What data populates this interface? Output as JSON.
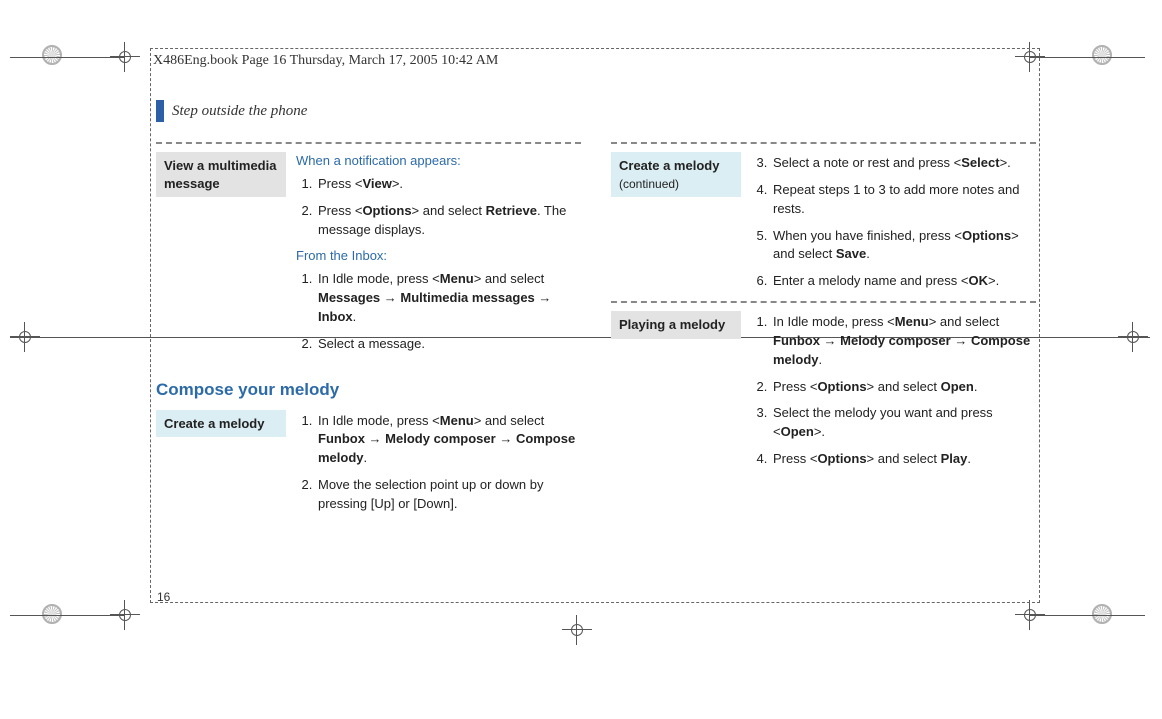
{
  "doc_header": "X486Eng.book  Page 16  Thursday, March 17, 2005  10:42 AM",
  "section_title": "Step outside the phone",
  "page_number": "16",
  "left": {
    "view_mm": {
      "label": "View a multimedia message",
      "notif_heading": "When a notification appears:",
      "notif_steps": [
        "Press <View>.",
        "Press <Options> and select Retrieve. The message displays."
      ],
      "inbox_heading": "From the Inbox:",
      "inbox_steps": [
        "In Idle mode, press <Menu> and select Messages → Multimedia messages → Inbox.",
        "Select a message."
      ]
    },
    "compose_heading": "Compose your melody",
    "create_melody": {
      "label": "Create a melody",
      "steps": [
        "In Idle mode, press <Menu> and select Funbox → Melody composer → Compose melody.",
        "Move the selection point up or down by pressing [Up] or [Down]."
      ]
    }
  },
  "right": {
    "create_cont": {
      "label": "Create a melody",
      "sub": "(continued)",
      "steps": [
        "Select a note or rest and press <Select>.",
        "Repeat steps 1 to 3 to add more notes and rests.",
        "When you have finished, press <Options> and select Save.",
        "Enter a melody name and press <OK>."
      ]
    },
    "play": {
      "label": "Playing a melody",
      "steps": [
        "In Idle mode, press <Menu> and select Funbox → Melody composer → Compose melody.",
        "Press <Options> and select Open.",
        "Select the melody you want and press <Open>.",
        "Press <Options> and select Play."
      ]
    }
  }
}
